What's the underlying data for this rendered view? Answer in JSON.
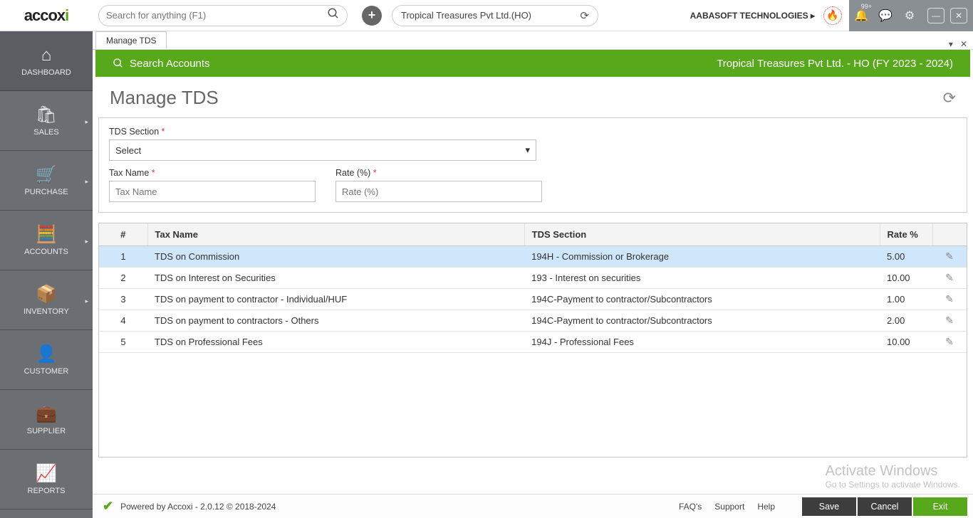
{
  "header": {
    "logo_main": "accox",
    "logo_accent": "i",
    "search_placeholder": "Search for anything (F1)",
    "org_name": "Tropical Treasures Pvt Ltd.(HO)",
    "company": "AABASOFT TECHNOLOGIES",
    "notif_badge": "99+"
  },
  "sidebar": {
    "items": [
      {
        "label": "DASHBOARD",
        "icon": "⌂",
        "arrow": ""
      },
      {
        "label": "SALES",
        "icon": "🛍",
        "arrow": "▸"
      },
      {
        "label": "PURCHASE",
        "icon": "🛒",
        "arrow": "▸"
      },
      {
        "label": "ACCOUNTS",
        "icon": "🧮",
        "arrow": "▸"
      },
      {
        "label": "INVENTORY",
        "icon": "📦",
        "arrow": "▸"
      },
      {
        "label": "CUSTOMER",
        "icon": "👤",
        "arrow": ""
      },
      {
        "label": "SUPPLIER",
        "icon": "💼",
        "arrow": ""
      },
      {
        "label": "REPORTS",
        "icon": "📈",
        "arrow": ""
      }
    ]
  },
  "tab": {
    "label": "Manage TDS"
  },
  "greenbar": {
    "search": "Search Accounts",
    "org": "Tropical Treasures Pvt Ltd. - HO (FY 2023 - 2024)"
  },
  "page": {
    "title": "Manage TDS"
  },
  "form": {
    "section_label": "TDS Section",
    "section_value": "Select",
    "taxname_label": "Tax Name",
    "taxname_placeholder": "Tax Name",
    "rate_label": "Rate (%)",
    "rate_placeholder": "Rate (%)"
  },
  "table": {
    "headers": {
      "num": "#",
      "name": "Tax Name",
      "section": "TDS Section",
      "rate": "Rate %"
    },
    "rows": [
      {
        "num": "1",
        "name": "TDS on Commission",
        "section": "194H - Commission or Brokerage",
        "rate": "5.00"
      },
      {
        "num": "2",
        "name": "TDS on Interest on Securities",
        "section": "193 - Interest on securities",
        "rate": "10.00"
      },
      {
        "num": "3",
        "name": "TDS on payment to contractor - Individual/HUF",
        "section": "194C-Payment to contractor/Subcontractors",
        "rate": "1.00"
      },
      {
        "num": "4",
        "name": "TDS on payment to contractors - Others",
        "section": "194C-Payment to contractor/Subcontractors",
        "rate": "2.00"
      },
      {
        "num": "5",
        "name": "TDS on Professional Fees",
        "section": "194J - Professional Fees",
        "rate": "10.00"
      }
    ]
  },
  "footer": {
    "powered": "Powered by Accoxi - 2.0.12 © 2018-2024",
    "links": {
      "faq": "FAQ's",
      "support": "Support",
      "help": "Help"
    },
    "buttons": {
      "save": "Save",
      "cancel": "Cancel",
      "exit": "Exit"
    }
  },
  "watermark": {
    "line1": "Activate Windows",
    "line2": "Go to Settings to activate Windows."
  }
}
